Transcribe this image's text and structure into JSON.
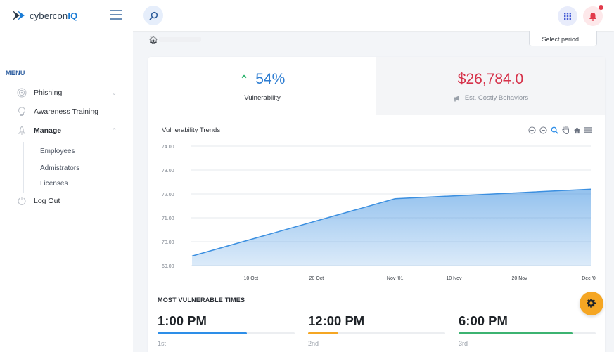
{
  "brand": {
    "prefix": "cybercon",
    "suffix": "IQ"
  },
  "header": {
    "period_select": "Select period..."
  },
  "sidebar": {
    "menu_title": "MENU",
    "items": [
      {
        "label": "Phishing",
        "icon": "target-icon"
      },
      {
        "label": "Awareness Training",
        "icon": "lightbulb-icon"
      },
      {
        "label": "Manage",
        "icon": "rocket-icon"
      },
      {
        "label": "Log Out",
        "icon": "power-icon"
      }
    ],
    "sub_items": [
      "Employees",
      "Admistrators",
      "Licenses"
    ]
  },
  "stats": {
    "vulnerability": {
      "value": "54%",
      "label": "Vulnerability",
      "trend": "up"
    },
    "costly": {
      "value": "$26,784.0",
      "label": "Est. Costly Behaviors"
    }
  },
  "chart": {
    "title": "Vulnerability Trends"
  },
  "chart_data": {
    "type": "area",
    "title": "Vulnerability Trends",
    "xlabel": "",
    "ylabel": "",
    "ylim": [
      69.0,
      74.0
    ],
    "y_ticks": [
      "74.00",
      "73.00",
      "72.00",
      "71.00",
      "70.00",
      "69.00"
    ],
    "x_ticks": [
      "10 Oct",
      "20 Oct",
      "Nov '01",
      "10 Nov",
      "20 Nov",
      "Dec '0"
    ],
    "series": [
      {
        "x": [
          "1 Oct",
          "1 Nov",
          "1 Dec"
        ],
        "values": [
          69.4,
          71.8,
          72.2
        ]
      }
    ],
    "grid": true,
    "color": "#3b8fe0"
  },
  "vulnerable_times": {
    "title": "MOST VULNERABLE TIMES",
    "items": [
      {
        "time": "1:00 PM",
        "rank": "1st",
        "progress": 0.65,
        "color": "#2d8ee8"
      },
      {
        "time": "12:00 PM",
        "rank": "2nd",
        "progress": 0.22,
        "color": "#f5a623"
      },
      {
        "time": "6:00 PM",
        "rank": "3rd",
        "progress": 0.83,
        "color": "#3cb371"
      }
    ]
  }
}
